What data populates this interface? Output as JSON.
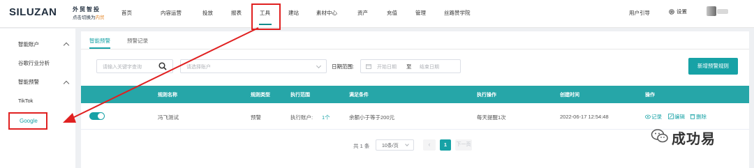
{
  "brand": {
    "logo": "SILUZAN",
    "cn_name": "外贸智投",
    "sub_text": "点击切换为",
    "sub_highlight": "内贸"
  },
  "nav": {
    "items": [
      "首页",
      "内容运营",
      "投放",
      "报表",
      "工具",
      "建站",
      "素材中心",
      "资产",
      "充值",
      "管理",
      "丝路赞学院"
    ],
    "active": "工具",
    "user_guide": "用户引导",
    "settings": "设置"
  },
  "sidebar": {
    "groups": [
      {
        "label": "智能账户",
        "children": [
          "谷歌行业分析"
        ]
      },
      {
        "label": "智能预警",
        "children": [
          "TikTok",
          "Google"
        ]
      }
    ],
    "selected": "Google"
  },
  "tabs": [
    "智能预警",
    "预警记录"
  ],
  "filters": {
    "keyword_placeholder": "请输入关键字查询",
    "account_placeholder": "请选择账户",
    "date_label": "日期范围:",
    "start_placeholder": "开始日期",
    "separator": "至",
    "end_placeholder": "结束日期",
    "new_rule_button": "新增预警规则"
  },
  "table": {
    "columns": [
      "规则名称",
      "规则类型",
      "执行范围",
      "满足条件",
      "执行操作",
      "创建时间",
      "操作"
    ],
    "rows": [
      {
        "enabled": true,
        "name": "冯飞测试",
        "type": "预警",
        "scope_label": "执行账户:",
        "scope_count": "1个",
        "condition": "余额小于等于200元",
        "action": "每天提醒1次",
        "created": "2022-06-17 12:54:48",
        "ops": [
          "记录",
          "编辑",
          "删除"
        ]
      }
    ]
  },
  "pagination": {
    "total": "共 1 条",
    "page_size": "10条/页",
    "current_page": "1",
    "next_label": "下一页"
  },
  "watermark": "成功易",
  "colors": {
    "accent": "#17a2a6",
    "table_header": "#26a6a8",
    "highlight_red": "#e02020"
  }
}
